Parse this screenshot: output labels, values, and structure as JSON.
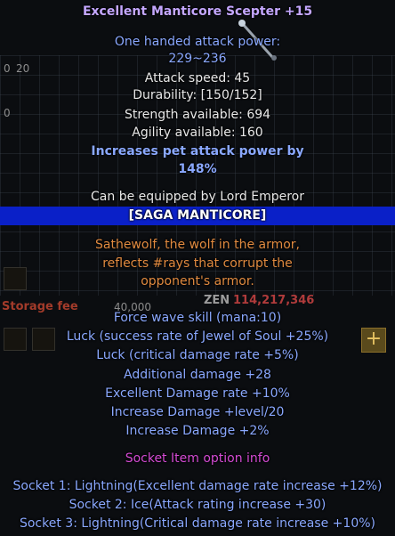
{
  "background": {
    "inventory_values": [
      "0",
      "20",
      "0"
    ],
    "storage_fee_label": "Storage fee",
    "storage_fee_value": "40,000",
    "zen_label": "ZEN",
    "zen_value": "114,217,346",
    "plus_label": "+"
  },
  "tooltip": {
    "title": "Excellent Manticore Scepter +15",
    "attack_line_1": "One handed attack power:",
    "attack_line_2": "229~236",
    "attack_speed": "Attack speed: 45",
    "durability": "Durability: [150/152]",
    "strength": "Strength available: 694",
    "agility": "Agility available: 160",
    "pet_line_1": "Increases pet attack power by",
    "pet_line_2": "148%",
    "equip": "Can be equipped by Lord Emperor",
    "set_name": "[SAGA MANTICORE]",
    "lore": [
      "Sathewolf, the wolf in the armor,",
      "reflects #rays that corrupt the",
      "opponent's armor."
    ],
    "options": [
      "Force wave skill (mana:10)",
      "Luck (success rate of Jewel of Soul +25%)",
      "Luck (critical damage rate +5%)",
      "Additional damage +28",
      "Excellent Damage rate +10%",
      "Increase Damage +level/20",
      "Increase Damage +2%"
    ],
    "socket_header": "Socket Item option info",
    "sockets": [
      "Socket 1: Lightning(Excellent damage rate increase +12%)",
      "Socket 2: Ice(Attack rating increase +30)",
      "Socket 3: Lightning(Critical damage rate increase +10%)"
    ]
  },
  "colors": {
    "title": "#c4a7ff",
    "stat": "#e8e8e8",
    "excellent_option": "#8aa8ff",
    "lore": "#e08a40",
    "socket_header": "#d44bd4",
    "set_bar": "#0a20c8"
  }
}
